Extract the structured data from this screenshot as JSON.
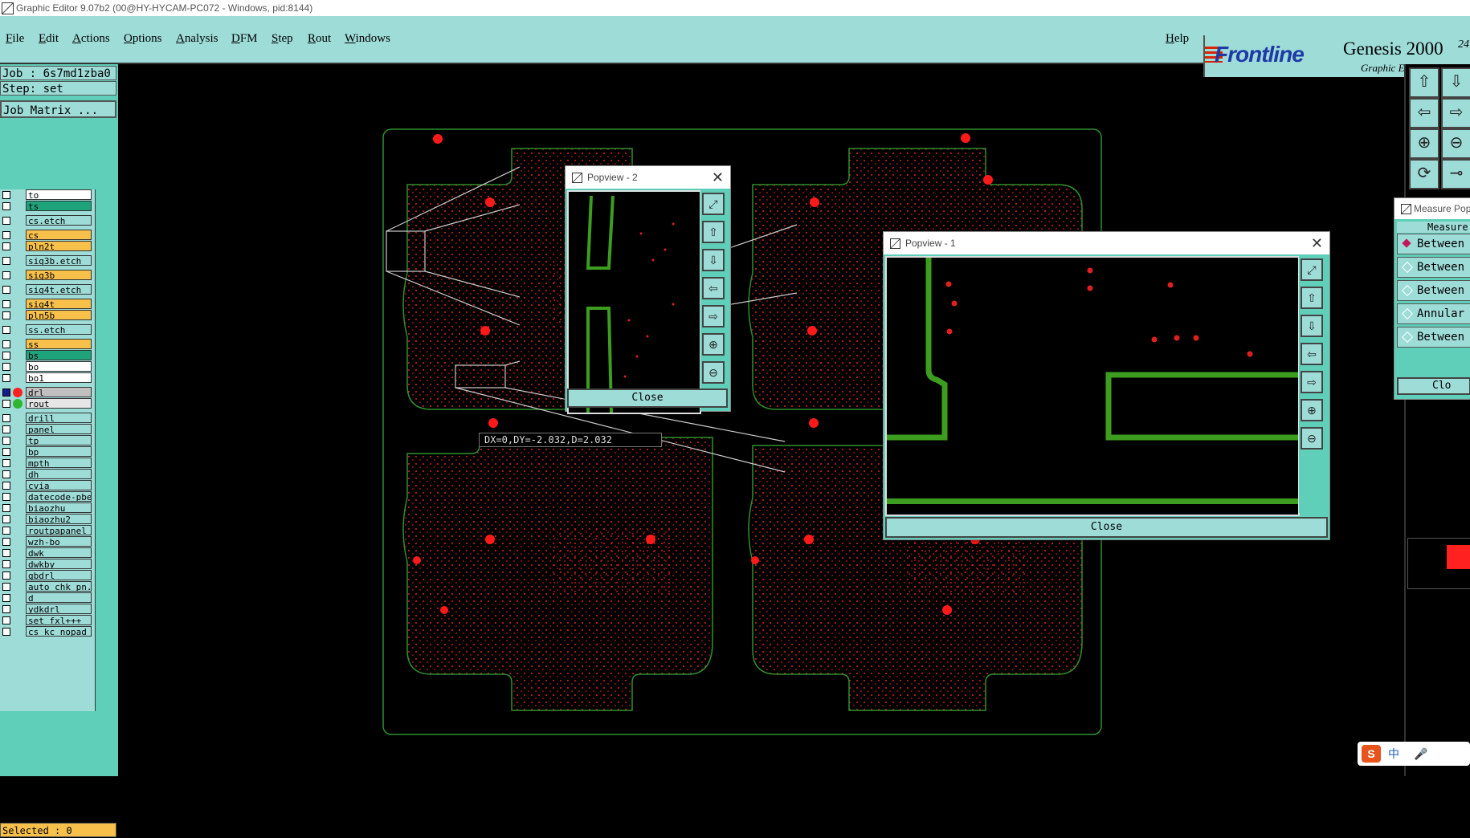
{
  "window": {
    "title": "Graphic Editor 9.07b2 (00@HY-HYCAM-PC072 - Windows, pid:8144)"
  },
  "menu": [
    "File",
    "Edit",
    "Actions",
    "Options",
    "Analysis",
    "DFM",
    "Step",
    "Rout",
    "Windows"
  ],
  "help": "Help",
  "brand": {
    "name": "Frontline",
    "product": "Genesis 2000",
    "sub": "Graphic Editor",
    "num": "24"
  },
  "job": {
    "label": "Job : 6s7md1zba0",
    "step": "Step: set",
    "matrix": "Job Matrix ..."
  },
  "layers": [
    {
      "name": "to",
      "color": "#ffffff"
    },
    {
      "name": "ts",
      "color": "#1fa37a"
    },
    {
      "name": "cs.etch",
      "color": "#9edcd8"
    },
    {
      "name": "cs",
      "color": "#f7c04a"
    },
    {
      "name": "pln2t",
      "color": "#f7c04a"
    },
    {
      "name": "sig3b.etch",
      "color": "#9edcd8"
    },
    {
      "name": "sig3b",
      "color": "#f7c04a"
    },
    {
      "name": "sig4t.etch",
      "color": "#9edcd8"
    },
    {
      "name": "sig4t",
      "color": "#f7c04a"
    },
    {
      "name": "pln5b",
      "color": "#f7c04a"
    },
    {
      "name": "ss.etch",
      "color": "#9edcd8"
    },
    {
      "name": "ss",
      "color": "#f7c04a"
    },
    {
      "name": "bs",
      "color": "#1fa37a"
    },
    {
      "name": "bo",
      "color": "#ffffff"
    },
    {
      "name": "bo1",
      "color": "#ffffff"
    },
    {
      "name": "drl",
      "color": "#c0c0c0",
      "dot": "#ff2020",
      "active": true
    },
    {
      "name": "rout",
      "color": "#e6e6e6",
      "dot": "#2fb52f"
    },
    {
      "name": "drill",
      "color": "#9edcd8"
    },
    {
      "name": "panel",
      "color": "#9edcd8"
    },
    {
      "name": "tp",
      "color": "#9edcd8"
    },
    {
      "name": "bp",
      "color": "#9edcd8"
    },
    {
      "name": "mpth",
      "color": "#9edcd8"
    },
    {
      "name": "dh",
      "color": "#9edcd8"
    },
    {
      "name": "cvia",
      "color": "#9edcd8"
    },
    {
      "name": "datecode-pbe",
      "color": "#9edcd8"
    },
    {
      "name": "biaozhu",
      "color": "#9edcd8"
    },
    {
      "name": "biaozhu2",
      "color": "#9edcd8"
    },
    {
      "name": "routpapanel",
      "color": "#9edcd8"
    },
    {
      "name": "wzh-bo",
      "color": "#9edcd8"
    },
    {
      "name": "dwk",
      "color": "#9edcd8"
    },
    {
      "name": "dwkby",
      "color": "#9edcd8"
    },
    {
      "name": "gbdrl",
      "color": "#9edcd8"
    },
    {
      "name": "auto_chk_pn.",
      "color": "#9edcd8"
    },
    {
      "name": "d",
      "color": "#9edcd8"
    },
    {
      "name": "ydkdrl",
      "color": "#9edcd8"
    },
    {
      "name": "set_fxl+++",
      "color": "#9edcd8"
    },
    {
      "name": "cs_kc_nopad",
      "color": "#9edcd8"
    }
  ],
  "selected": "Selected : 0",
  "readout": "DX=0,DY=-2.032,D=2.032",
  "popview2": {
    "title": "Popview - 2",
    "close": "Close"
  },
  "popview1": {
    "title": "Popview - 1",
    "close": "Close"
  },
  "measure": {
    "title": "Measure Pop",
    "label": "Measure",
    "rows": [
      "Between",
      "Between",
      "Between",
      "Annular",
      "Between"
    ],
    "close": "Clo"
  },
  "ime": "中"
}
